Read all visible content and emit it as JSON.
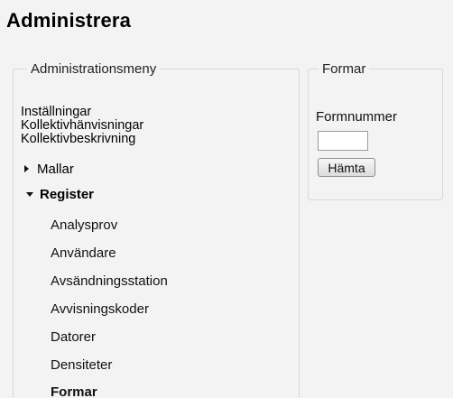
{
  "page": {
    "title": "Administrera"
  },
  "admin_menu": {
    "legend": "Administrationsmeny",
    "links": [
      {
        "label": "Inställningar"
      },
      {
        "label": "Kollektivhänvisningar"
      },
      {
        "label": "Kollektivbeskrivning"
      }
    ],
    "collapsed_group": {
      "label": "Mallar",
      "icon": "triangle-right-icon"
    },
    "expanded_group": {
      "label": "Register",
      "icon": "triangle-down-icon"
    },
    "register_items": [
      {
        "label": "Analysprov"
      },
      {
        "label": "Användare"
      },
      {
        "label": "Avsändningsstation"
      },
      {
        "label": "Avvisningskoder"
      },
      {
        "label": "Datorer"
      },
      {
        "label": "Densiteter"
      },
      {
        "label": "Formar",
        "selected": true
      }
    ]
  },
  "form_panel": {
    "legend": "Formar",
    "field_label": "Formnummer",
    "field_value": "",
    "button_label": "Hämta"
  }
}
